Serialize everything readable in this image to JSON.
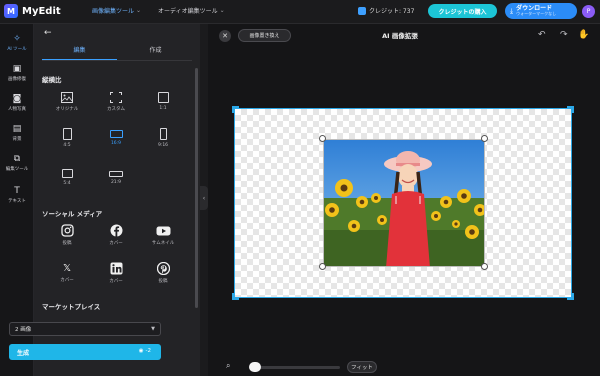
{
  "app": {
    "name": "MyEdit",
    "logo_letter": "M"
  },
  "topnav": {
    "items": [
      {
        "label": "画像編集ツール",
        "active": true
      },
      {
        "label": "オーディオ編集ツール",
        "active": false
      }
    ],
    "credits_label": "クレジット: 737",
    "buy_credits": "クレジットの購入",
    "download_label": "ダウンロード",
    "download_sub": "ウォーターマークなし",
    "avatar_letter": "P"
  },
  "rail": [
    {
      "label": "AI ツール",
      "icon": "magic-wand-icon",
      "glyph": "✧",
      "active": true
    },
    {
      "label": "画像修復",
      "icon": "image-repair-icon",
      "glyph": "▣",
      "active": false
    },
    {
      "label": "人物写真",
      "icon": "portrait-icon",
      "glyph": "◙",
      "active": false
    },
    {
      "label": "背景",
      "icon": "background-icon",
      "glyph": "▤",
      "active": false
    },
    {
      "label": "編集ツール",
      "icon": "edit-tools-icon",
      "glyph": "⧉",
      "active": false
    },
    {
      "label": "テキスト",
      "icon": "text-icon",
      "glyph": "T",
      "active": false
    }
  ],
  "panel": {
    "tabs": [
      {
        "label": "編集",
        "active": true
      },
      {
        "label": "作成",
        "active": false
      }
    ],
    "aspect_title": "縦横比",
    "aspect_items": [
      {
        "label": "オリジナル",
        "kind": "original"
      },
      {
        "label": "カスタム",
        "kind": "custom"
      },
      {
        "label": "1:1",
        "kind": "1x1"
      },
      {
        "label": "4:5",
        "kind": "4x5"
      },
      {
        "label": "16:9",
        "kind": "16x9",
        "selected": true
      },
      {
        "label": "9:16",
        "kind": "9x16"
      },
      {
        "label": "5:4",
        "kind": "5x4"
      },
      {
        "label": "21:9",
        "kind": "21x9"
      }
    ],
    "social_title": "ソーシャル メディア",
    "social_items": [
      {
        "label": "投稿",
        "icon": "instagram-icon"
      },
      {
        "label": "カバー",
        "icon": "facebook-icon"
      },
      {
        "label": "サムネイル",
        "icon": "youtube-icon"
      },
      {
        "label": "カバー",
        "icon": "x-icon"
      },
      {
        "label": "カバー",
        "icon": "linkedin-icon"
      },
      {
        "label": "投稿",
        "icon": "pinterest-icon"
      }
    ],
    "market_title": "マーケットプレイス",
    "count_select": "2 画像",
    "generate_label": "生成",
    "generate_cost": "-2"
  },
  "canvas": {
    "replace_label": "画像置き換え",
    "title": "AI 画像拡張",
    "fit_label": "フィット"
  },
  "colors": {
    "accent": "#3aa0ff",
    "frame": "#2ba8e8",
    "generate": "#1fb6e8",
    "buy": "#1cc5d6"
  }
}
